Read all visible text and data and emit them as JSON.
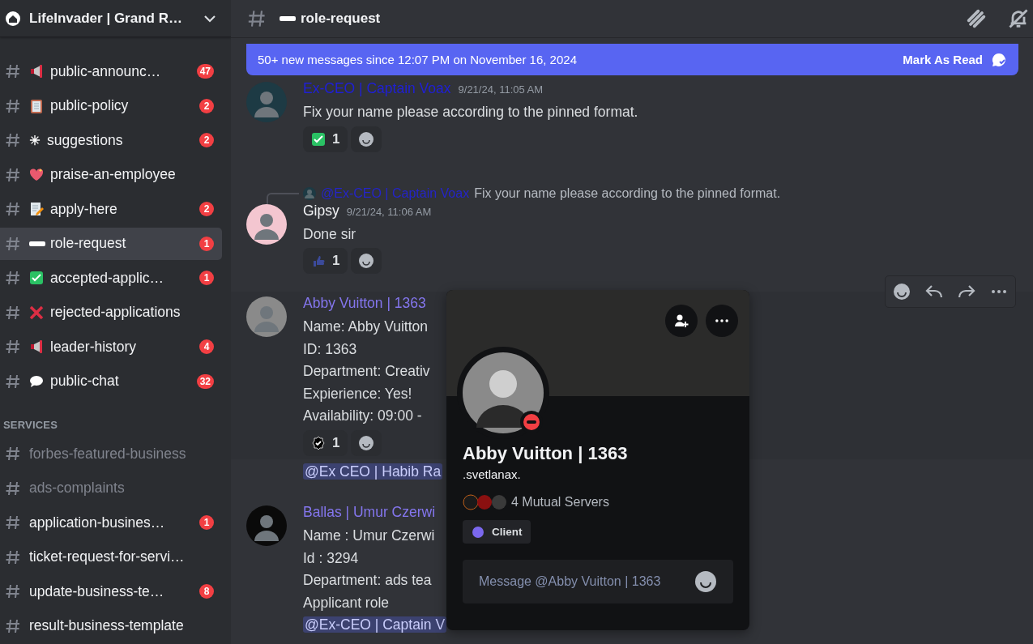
{
  "server": {
    "name": "LifeInvader | Grand R…"
  },
  "sidebar": {
    "sections": [
      {
        "channels": [
          {
            "name": "public-announc…",
            "badge": "47",
            "unread": true,
            "selected": false
          },
          {
            "name": "public-policy",
            "badge": "2",
            "unread": true,
            "selected": false
          },
          {
            "name": "suggestions",
            "badge": "2",
            "unread": true,
            "selected": false
          },
          {
            "name": "praise-an-employee",
            "unread": true,
            "selected": false
          },
          {
            "name": "apply-here",
            "badge": "2",
            "unread": true,
            "selected": false
          },
          {
            "name": "role-request",
            "badge": "1",
            "unread": true,
            "selected": true
          },
          {
            "name": "accepted-applic…",
            "badge": "1",
            "unread": true,
            "selected": false
          },
          {
            "name": "rejected-applications",
            "unread": true,
            "selected": false
          },
          {
            "name": "leader-history",
            "badge": "4",
            "unread": true,
            "selected": false
          },
          {
            "name": "public-chat",
            "badge": "32",
            "unread": true,
            "selected": false
          }
        ]
      },
      {
        "title": "SERVICES",
        "channels": [
          {
            "name": "forbes-featured-business",
            "unread": false,
            "selected": false
          },
          {
            "name": "ads-complaints",
            "unread": false,
            "selected": false
          },
          {
            "name": "application-busines…",
            "badge": "1",
            "unread": true,
            "selected": false
          },
          {
            "name": "ticket-request-for-servi…",
            "unread": true,
            "selected": false
          },
          {
            "name": "update-business-te…",
            "badge": "8",
            "unread": true,
            "selected": false
          },
          {
            "name": "result-business-template",
            "unread": true,
            "selected": false
          }
        ]
      }
    ]
  },
  "channel": {
    "name": "role-request"
  },
  "banner": {
    "text": "50+ new messages since 12:07 PM on November 16, 2024",
    "action": "Mark As Read"
  },
  "messages": [
    {
      "kind": "full",
      "author": "Ex-CEO | Captain Voax",
      "color": "#1f1fd6",
      "time": "9/21/24, 11:05 AM",
      "hovered": false,
      "lines": [
        "Fix your name please according to the pinned format."
      ],
      "reactions": [
        {
          "kind": "check",
          "count": "1"
        }
      ]
    },
    {
      "kind": "full",
      "reply": {
        "author": "@Ex-CEO | Captain Voax",
        "text": "Fix your name please according to the pinned format."
      },
      "author": "Gipsy",
      "color": "#f2f3f5",
      "time": "9/21/24, 11:06 AM",
      "hovered": false,
      "lines": [
        "Done sir"
      ],
      "reactions": [
        {
          "kind": "thumb",
          "count": "1"
        }
      ]
    },
    {
      "kind": "full",
      "author": "Abby Vuitton | 1363",
      "color": "#8476ee",
      "hovered": true,
      "lines": [
        "Name: Abby Vuitton",
        "ID: 1363",
        "Department: Creativ",
        "Expierience: Yes!",
        "Availability: 09:00 -"
      ],
      "reactions": [
        {
          "kind": "badge",
          "count": "1"
        }
      ]
    },
    {
      "kind": "compact",
      "hovered": false,
      "mention": "@Ex CEO | Habib Ra"
    },
    {
      "kind": "full",
      "author": "Ballas | Umur Czerwi",
      "color": "#8476ee",
      "hovered": false,
      "lines": [
        "Name : Umur Czerwi",
        "Id : 3294",
        "Department: ads tea",
        "Applicant role"
      ],
      "mention": "@Ex-CEO | Captain V"
    }
  ],
  "profile": {
    "display_name": "Abby Vuitton | 1363",
    "username": ".svetlanax.",
    "mutual": "4 Mutual Servers",
    "roles": [
      {
        "name": "Client",
        "color": "#7b68ee"
      }
    ],
    "placeholder": "Message @Abby Vuitton | 1363"
  }
}
